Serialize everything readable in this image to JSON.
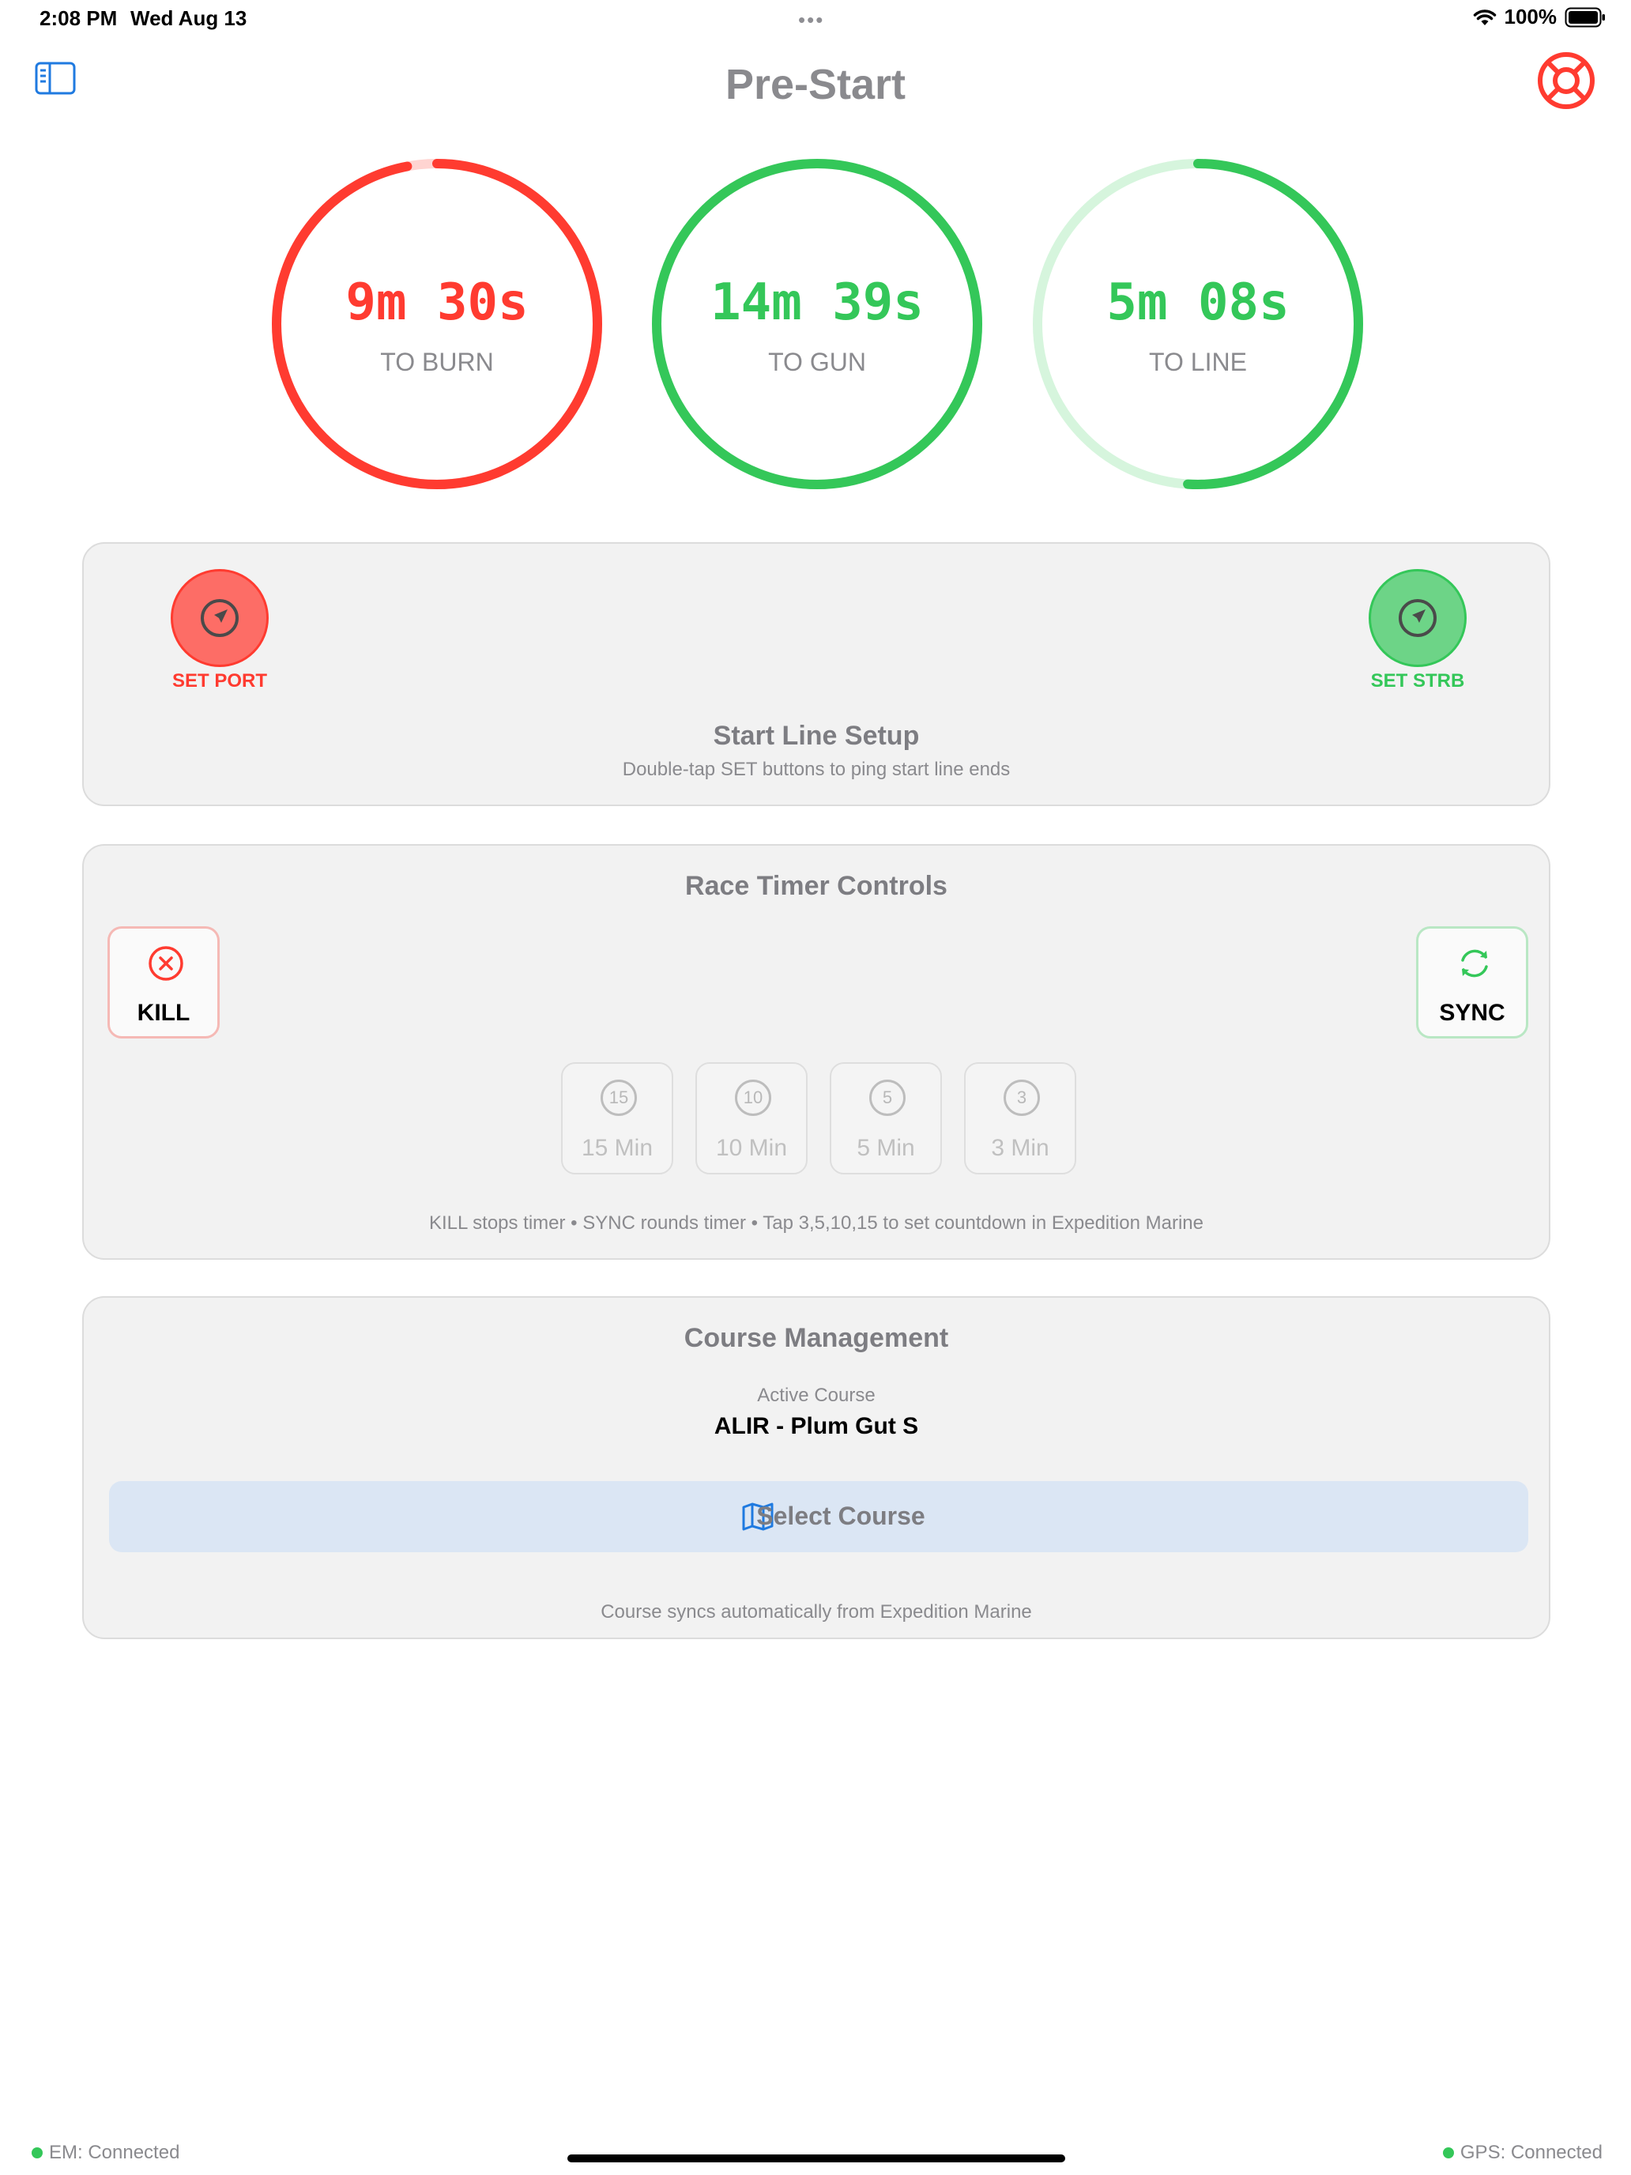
{
  "status_bar": {
    "time": "2:08 PM",
    "date": "Wed Aug 13",
    "battery": "100%"
  },
  "nav": {
    "title": "Pre-Start",
    "sidebar_icon": "sidebar-icon",
    "help_icon": "lifebuoy-icon"
  },
  "timers": [
    {
      "value": "9m 30s",
      "label": "TO BURN",
      "color": "#ff3b30",
      "track": "#ffd4d1",
      "progress": 0.97
    },
    {
      "value": "14m 39s",
      "label": "TO GUN",
      "color": "#34c759",
      "track": "#d6f5dd",
      "progress": 1.0
    },
    {
      "value": "5m 08s",
      "label": "TO LINE",
      "color": "#34c759",
      "track": "#d6f5dd",
      "progress": 0.51
    }
  ],
  "start_line": {
    "title": "Start Line Setup",
    "subtitle": "Double-tap SET buttons to ping start line ends",
    "port_label": "SET PORT",
    "strb_label": "SET STRB",
    "port_color": "#ff3b30",
    "strb_color": "#34c759"
  },
  "race_timer": {
    "title": "Race Timer Controls",
    "kill_label": "KILL",
    "sync_label": "SYNC",
    "presets": [
      {
        "num": "15",
        "label": "15 Min"
      },
      {
        "num": "10",
        "label": "10 Min"
      },
      {
        "num": "5",
        "label": "5 Min"
      },
      {
        "num": "3",
        "label": "3 Min"
      }
    ],
    "hint": "KILL stops timer • SYNC rounds timer • Tap 3,5,10,15 to set countdown in Expedition Marine"
  },
  "course": {
    "title": "Course Management",
    "active_label": "Active Course",
    "active_value": "ALIR - Plum Gut S",
    "select_label": "Select Course",
    "footnote": "Course syncs automatically from Expedition Marine"
  },
  "footer": {
    "em_status": "EM: Connected",
    "gps_status": "GPS: Connected"
  }
}
